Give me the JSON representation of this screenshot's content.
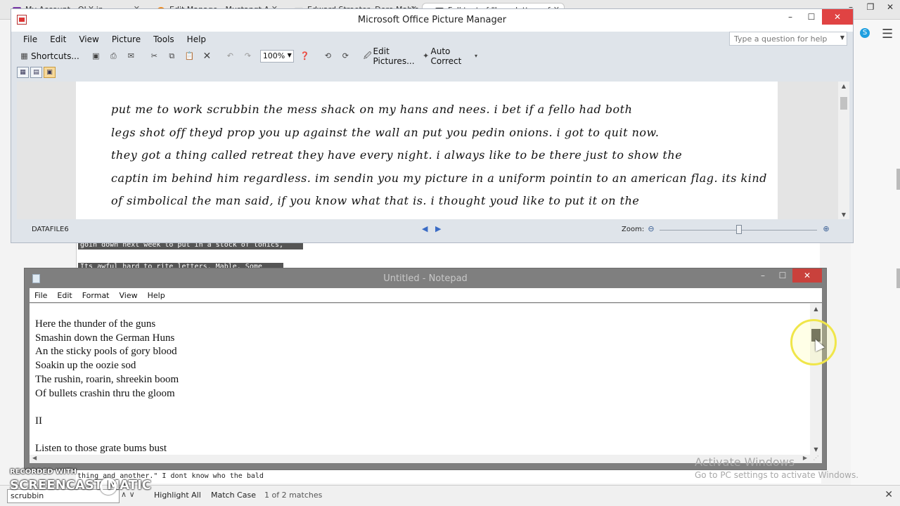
{
  "browser": {
    "tabs": [
      {
        "label": "My Account - OLX.in",
        "x": 0
      },
      {
        "label": "Edit Manage - Mustangt A",
        "x": 0
      },
      {
        "label": "Edward Streeter, Dere Mable, l",
        "x": 0
      },
      {
        "label": "Full text of \"Love letters of",
        "x": 0
      }
    ]
  },
  "picture_manager": {
    "title": "Microsoft Office Picture Manager",
    "menu": [
      "File",
      "Edit",
      "View",
      "Picture",
      "Tools",
      "Help"
    ],
    "help_placeholder": "Type a question for help",
    "toolbar": {
      "shortcuts": "Shortcuts...",
      "zoom": "100%",
      "edit_pictures": "Edit Pictures...",
      "auto_correct": "Auto Correct"
    },
    "page_lines": [
      "put me to work scrubbin the mess shack on my hans and nees. i bet if a fello had both",
      "legs shot off theyd prop you up against the wall an put you pedin onions. i got to quit now.",
      "they got a thing called retreat they have every night. i always like to be there just to show the",
      "captin im behind him regardless. im sendin you my picture in a uniform pointin to an american flag. its kind",
      "of simbolical the man said, if you know what that is. i thought youd like to put it on the"
    ],
    "status": {
      "file_name": "DATAFILE6",
      "zoom_label": "Zoom:"
    }
  },
  "doc_background": {
    "line1": "goin down next week to put in a stock of tonics,",
    "line2": "Its awful hard to rite letters, Mable. Some",
    "line3": "thing and another.\" I dont know who the bald"
  },
  "notepad": {
    "title": "Untitled - Notepad",
    "menu": [
      "File",
      "Edit",
      "Format",
      "View",
      "Help"
    ],
    "content": "Here the thunder of the guns\nSmashin down the German Huns\nAn the sticky pools of gory blood\nSoakin up the oozie sod\nThe rushin, roarin, shreekin boom\nOf bullets crashin thru the gloom\n\nII\n\nListen to those grate bums bust"
  },
  "findbar": {
    "query": "scrubbin",
    "highlight_all": "Highlight All",
    "match_case": "Match Case",
    "matches": "1 of 2 matches"
  },
  "watermark": {
    "recorded": "RECORDED WITH",
    "brand": "SCREENCAST   MATIC"
  },
  "activate": {
    "line1": "Activate Windows",
    "line2": "Go to PC settings to activate Windows."
  }
}
